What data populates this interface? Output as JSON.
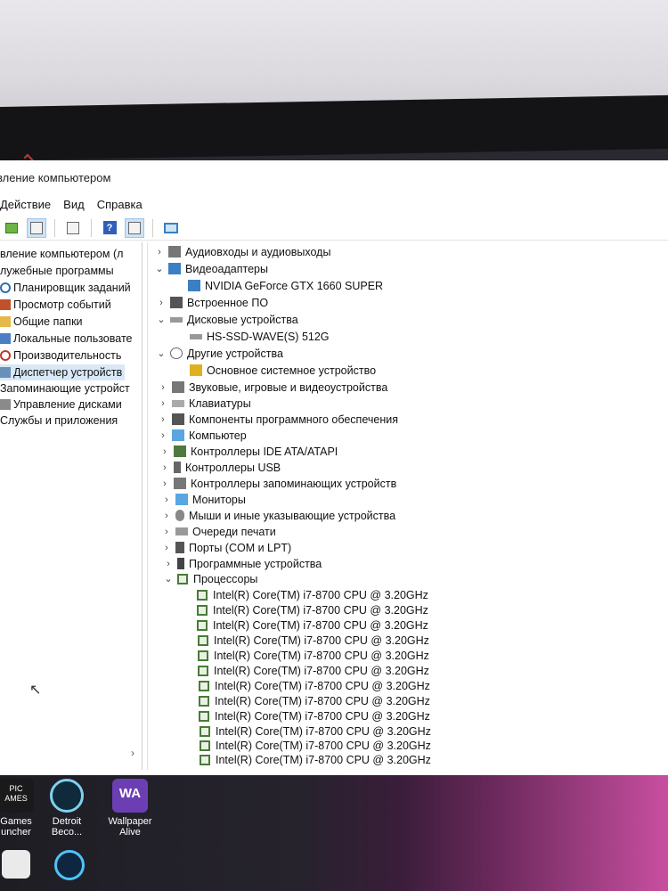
{
  "window": {
    "title": "вление компьютером"
  },
  "menu": [
    "Действие",
    "Вид",
    "Справка"
  ],
  "toolbar": {
    "icons": [
      "up-folder-icon",
      "properties-icon",
      "console-tree-icon",
      "help-icon",
      "details-icon",
      "monitor-icon"
    ]
  },
  "left_pane": {
    "items": [
      {
        "label": "вление компьютером (л",
        "icon": "computer-management-icon"
      },
      {
        "label": "лужебные программы",
        "icon": "tools-icon"
      },
      {
        "label": "Планировщик заданий",
        "icon": "clock-icon"
      },
      {
        "label": "Просмотр событий",
        "icon": "event-viewer-icon"
      },
      {
        "label": "Общие папки",
        "icon": "shared-folder-icon"
      },
      {
        "label": "Локальные пользовате",
        "icon": "users-icon"
      },
      {
        "label": "Производительность",
        "icon": "performance-icon"
      },
      {
        "label": "Диспетчер устройств",
        "icon": "device-manager-icon",
        "selected": true
      },
      {
        "label": "Запоминающие устройст",
        "icon": ""
      },
      {
        "label": "Управление дисками",
        "icon": "disk-management-icon"
      },
      {
        "label": "Службы и приложения",
        "icon": ""
      }
    ]
  },
  "device_tree": [
    {
      "label": "Аудиовходы и аудиовыходы",
      "expanded": false,
      "icon": "audio-icon",
      "level": 0
    },
    {
      "label": "Видеоадаптеры",
      "expanded": true,
      "icon": "display-adapter-icon",
      "level": 0
    },
    {
      "label": "NVIDIA GeForce GTX 1660 SUPER",
      "icon": "display-adapter-icon",
      "level": 1
    },
    {
      "label": "Встроенное ПО",
      "expanded": false,
      "icon": "firmware-icon",
      "level": 0
    },
    {
      "label": "Дисковые устройства",
      "expanded": true,
      "icon": "disk-icon",
      "level": 0
    },
    {
      "label": "HS-SSD-WAVE(S) 512G",
      "icon": "disk-icon",
      "level": 1
    },
    {
      "label": "Другие устройства",
      "expanded": true,
      "icon": "unknown-device-icon",
      "level": 0
    },
    {
      "label": "Основное системное устройство",
      "icon": "warning-device-icon",
      "level": 1
    },
    {
      "label": "Звуковые, игровые и видеоустройства",
      "expanded": false,
      "icon": "sound-icon",
      "level": 0
    },
    {
      "label": "Клавиатуры",
      "expanded": false,
      "icon": "keyboard-icon",
      "level": 0
    },
    {
      "label": "Компоненты программного обеспечения",
      "expanded": false,
      "icon": "software-component-icon",
      "level": 0
    },
    {
      "label": "Компьютер",
      "expanded": false,
      "icon": "computer-icon",
      "level": 0
    },
    {
      "label": "Контроллеры IDE ATA/ATAPI",
      "expanded": false,
      "icon": "ide-icon",
      "level": 0
    },
    {
      "label": "Контроллеры USB",
      "expanded": false,
      "icon": "usb-icon",
      "level": 0
    },
    {
      "label": "Контроллеры запоминающих устройств",
      "expanded": false,
      "icon": "storage-controller-icon",
      "level": 0
    },
    {
      "label": "Мониторы",
      "expanded": false,
      "icon": "monitor-icon",
      "level": 0
    },
    {
      "label": "Мыши и иные указывающие устройства",
      "expanded": false,
      "icon": "mouse-icon",
      "level": 0
    },
    {
      "label": "Очереди печати",
      "expanded": false,
      "icon": "printer-icon",
      "level": 0
    },
    {
      "label": "Порты (COM и LPT)",
      "expanded": false,
      "icon": "port-icon",
      "level": 0
    },
    {
      "label": "Программные устройства",
      "expanded": false,
      "icon": "software-device-icon",
      "level": 0
    },
    {
      "label": "Процессоры",
      "expanded": true,
      "icon": "processor-icon",
      "level": 0
    }
  ],
  "processors": [
    "Intel(R) Core(TM) i7-8700 CPU @ 3.20GHz",
    "Intel(R) Core(TM) i7-8700 CPU @ 3.20GHz",
    "Intel(R) Core(TM) i7-8700 CPU @ 3.20GHz",
    "Intel(R) Core(TM) i7-8700 CPU @ 3.20GHz",
    "Intel(R) Core(TM) i7-8700 CPU @ 3.20GHz",
    "Intel(R) Core(TM) i7-8700 CPU @ 3.20GHz",
    "Intel(R) Core(TM) i7-8700 CPU @ 3.20GHz",
    "Intel(R) Core(TM) i7-8700 CPU @ 3.20GHz",
    "Intel(R) Core(TM) i7-8700 CPU @ 3.20GHz",
    "Intel(R) Core(TM) i7-8700 CPU @ 3.20GHz",
    "Intel(R) Core(TM) i7-8700 CPU @ 3.20GHz",
    "Intel(R) Core(TM) i7-8700 CPU @ 3.20GHz"
  ],
  "desktop_icons": [
    {
      "label": "Games\nuncher",
      "badge": "PIC\nAMES",
      "color": "#1a1a1a"
    },
    {
      "label": "Detroit\nBeco...",
      "badge": "",
      "color": "#0f2a3a"
    },
    {
      "label": "Wallpaper\nAlive",
      "badge": "WA",
      "color": "#6b3fb3"
    },
    {
      "label": "",
      "badge": "",
      "color": "#222"
    },
    {
      "label": "",
      "badge": "",
      "color": "#0e2640"
    }
  ]
}
